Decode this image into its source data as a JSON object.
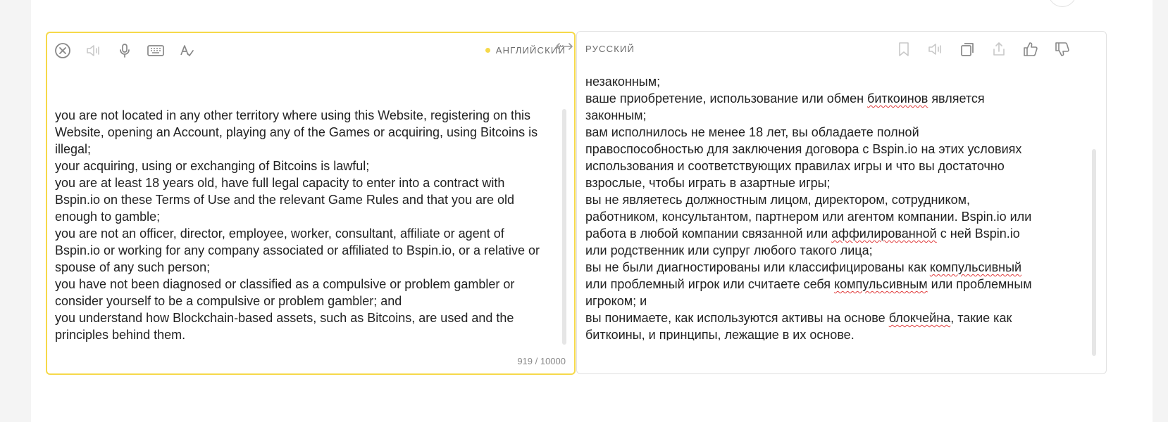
{
  "source": {
    "language_label": "АНГЛИЙСКИЙ",
    "text": "you are not located in any other territory where using this Website, registering on this Website, opening an Account, playing any of the Games or acquiring, using Bitcoins is illegal;\nyour acquiring, using or exchanging of Bitcoins is lawful;\nyou are at least 18 years old, have full legal capacity to enter into a contract with Bspin.io on these Terms of Use and the relevant Game Rules and that you are old enough to gamble;\nyou are not an officer, director, employee, worker, consultant, affiliate or agent of Bspin.io or working for any company associated or affiliated to Bspin.io, or a relative or spouse of any such person;\nyou have not been diagnosed or classified as a compulsive or problem gambler or consider yourself to be a compulsive or problem gambler; and\nyou understand how Blockchain-based assets, such as Bitcoins, are used and the principles behind them.",
    "char_counter": "919 / 10000",
    "toolbar_icons": [
      "clear-icon",
      "speaker-muted-icon",
      "microphone-icon",
      "keyboard-icon",
      "spellcheck-icon"
    ]
  },
  "target": {
    "language_label": "РУССКИЙ",
    "lines": [
      [
        "незаконным;"
      ],
      [
        "ваше приобретение, использование или обмен ",
        {
          "err": "биткоинов"
        },
        " является"
      ],
      [
        "законным;"
      ],
      [
        "вам исполнилось не менее 18 лет, вы обладаете полной"
      ],
      [
        "правоспособностью для заключения договора с Bspin.io на этих условиях"
      ],
      [
        "использования и соответствующих правилах игры и что вы достаточно"
      ],
      [
        "взрослые, чтобы играть в азартные игры;"
      ],
      [
        "вы не являетесь должностным лицом, директором, сотрудником,"
      ],
      [
        "работником, консультантом, партнером или агентом компании. Bspin.io или"
      ],
      [
        "работа в любой компании связанной или ",
        {
          "err": "аффилированной"
        },
        " с ней Bspin.io"
      ],
      [
        "или родственник или супруг любого такого лица;"
      ],
      [
        "вы не были диагностированы или классифицированы как ",
        {
          "err": "компульсивный"
        }
      ],
      [
        "или проблемный игрок или считаете себя ",
        {
          "err": "компульсивным"
        },
        " или проблемным"
      ],
      [
        "игроком; и"
      ],
      [
        "вы понимаете, как используются активы на основе ",
        {
          "err": "блокчейна"
        },
        ", такие как"
      ],
      [
        {
          "err": "биткоины"
        },
        ", и принципы, лежащие в их основе."
      ]
    ],
    "toolbar_icons": [
      "bookmark-icon",
      "speaker-muted-icon",
      "copy-icon",
      "share-icon",
      "thumbs-up-icon",
      "thumbs-down-icon"
    ]
  },
  "colors": {
    "accent": "#f6d94a",
    "spell_error": "#e03c3c"
  }
}
